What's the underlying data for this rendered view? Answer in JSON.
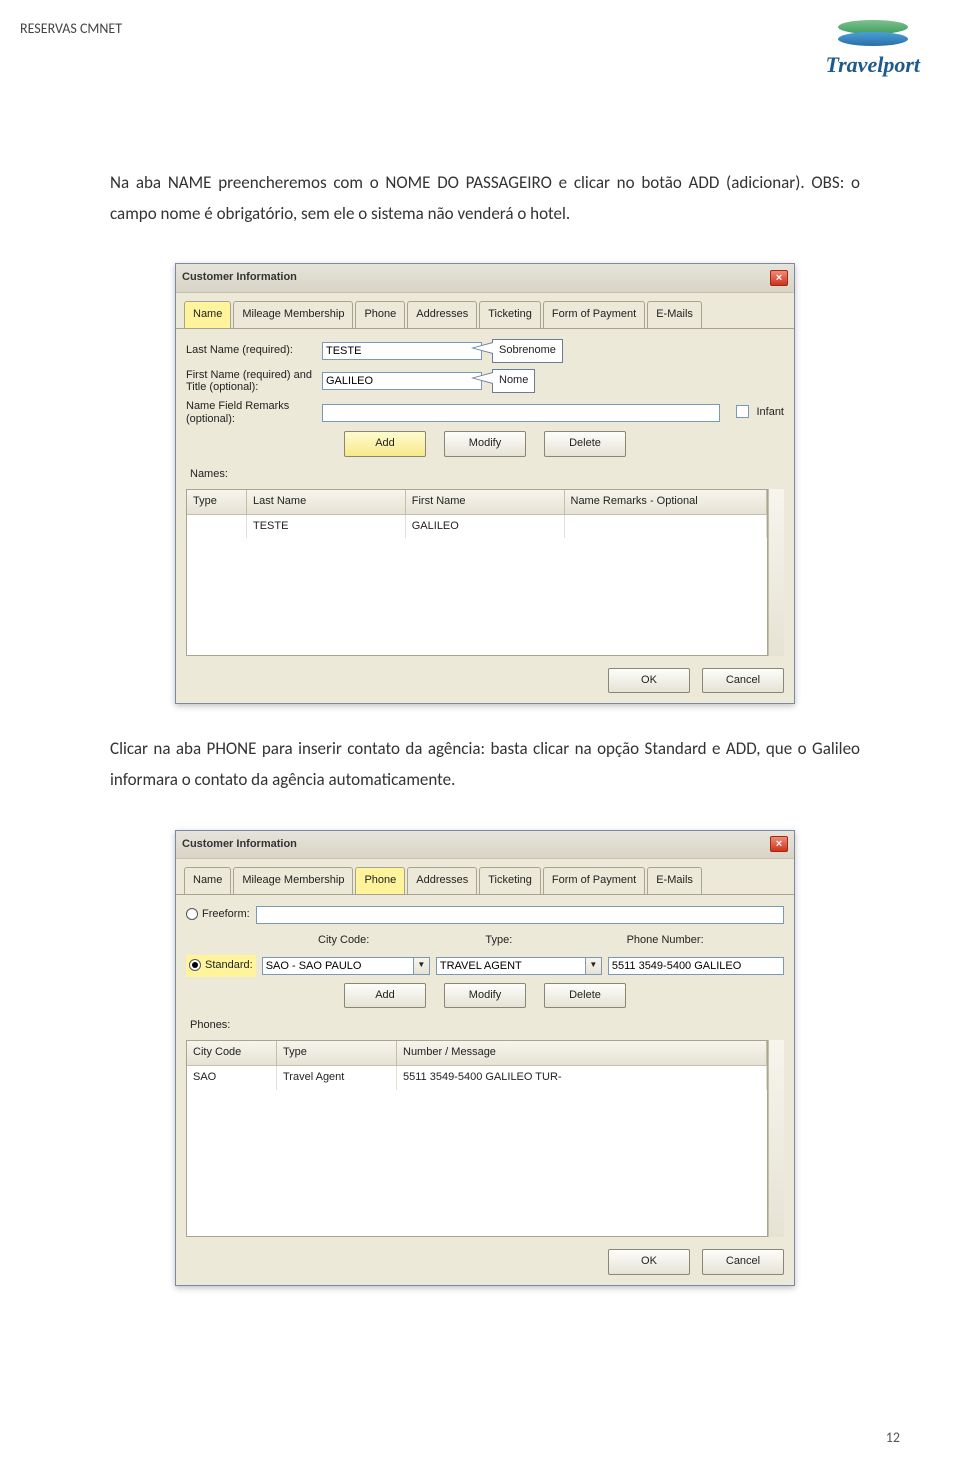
{
  "header": {
    "title": "RESERVAS CMNET",
    "logo_text": "Travelport"
  },
  "body": {
    "p1": "Na aba NAME preencheremos com o NOME DO PASSAGEIRO e clicar no botão ADD (adicionar). OBS: o campo nome é obrigatório, sem ele o sistema não venderá o hotel.",
    "p2": "Clicar na aba PHONE para inserir contato da agência: basta clicar na opção Standard e ADD, que o Galileo informara o contato da agência automaticamente."
  },
  "win1": {
    "title": "Customer Information",
    "tabs": [
      "Name",
      "Mileage Membership",
      "Phone",
      "Addresses",
      "Ticketing",
      "Form of Payment",
      "E-Mails"
    ],
    "labels": {
      "last": "Last Name (required):",
      "first": "First Name (required) and Title (optional):",
      "remarks": "Name Field Remarks (optional):",
      "infant": "Infant",
      "names": "Names:"
    },
    "vals": {
      "last": "TESTE",
      "first": "GALILEO"
    },
    "callouts": {
      "last": "Sobrenome",
      "first": "Nome"
    },
    "btns": {
      "add": "Add",
      "mod": "Modify",
      "del": "Delete",
      "ok": "OK",
      "cancel": "Cancel"
    },
    "grid": {
      "headers": [
        "Type",
        "Last Name",
        "First Name",
        "Name Remarks - Optional"
      ],
      "row": [
        "",
        "TESTE",
        "GALILEO",
        ""
      ]
    }
  },
  "win2": {
    "title": "Customer Information",
    "tabs": [
      "Name",
      "Mileage Membership",
      "Phone",
      "Addresses",
      "Ticketing",
      "Form of Payment",
      "E-Mails"
    ],
    "radios": {
      "free": "Freeform:",
      "std": "Standard:"
    },
    "cols": {
      "city": "City Code:",
      "type": "Type:",
      "num": "Phone Number:"
    },
    "vals": {
      "city": "SAO - SAO PAULO",
      "type": "TRAVEL AGENT",
      "num": "5511 3549-5400 GALILEO"
    },
    "btns": {
      "add": "Add",
      "mod": "Modify",
      "del": "Delete",
      "ok": "OK",
      "cancel": "Cancel"
    },
    "section": "Phones:",
    "grid": {
      "headers": [
        "City Code",
        "Type",
        "Number / Message"
      ],
      "row": [
        "SAO",
        "Travel Agent",
        "5511 3549-5400 GALILEO TUR-"
      ]
    }
  },
  "page_num": "12"
}
